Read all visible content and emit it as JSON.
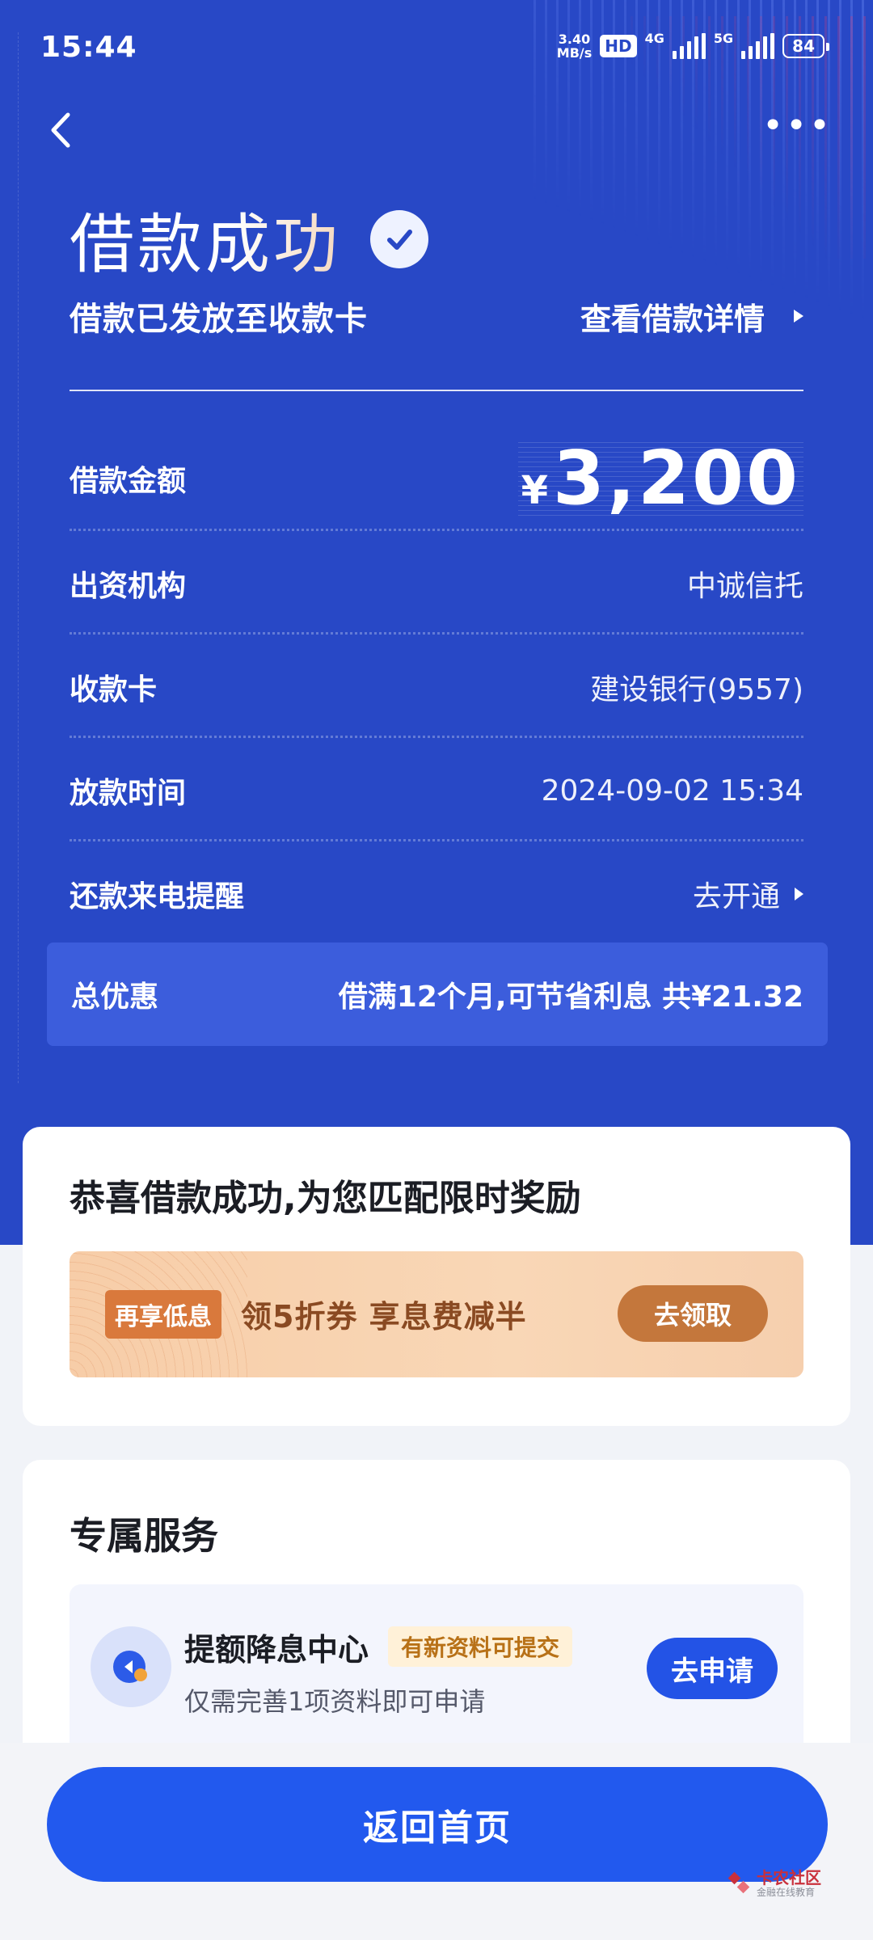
{
  "status_bar": {
    "time": "15:44",
    "speed_value": "3.40",
    "speed_unit": "MB/s",
    "hd": "HD",
    "net1": "4G",
    "net2": "5G",
    "battery": "84"
  },
  "nav": {
    "back_icon": "chevron-left-icon",
    "more_icon": "more-dots-icon"
  },
  "header": {
    "title": "借款成功",
    "subtitle": "借款已发放至收款卡",
    "details_link": "查看借款详情"
  },
  "loan": {
    "amount_label": "借款金额",
    "currency": "¥",
    "amount": "3,200",
    "lender_label": "出资机构",
    "lender": "中诚信托",
    "card_label": "收款卡",
    "card": "建设银行(9557)",
    "time_label": "放款时间",
    "time": "2024-09-02 15:34",
    "reminder_label": "还款来电提醒",
    "reminder_action": "去开通"
  },
  "discount": {
    "label": "总优惠",
    "value": "借满12个月,可节省利息 共¥21.32"
  },
  "reward": {
    "heading": "恭喜借款成功,为您匹配限时奖励",
    "tag": "再享低息",
    "text": "领5折券 享息费减半",
    "button": "去领取"
  },
  "services": {
    "heading": "专属服务",
    "item": {
      "name": "提额降息中心",
      "badge": "有新资料可提交",
      "desc": "仅需完善1项资料即可申请",
      "button": "去申请"
    }
  },
  "footer": {
    "home_button": "返回首页",
    "watermark_main": "卡农社区",
    "watermark_sub": "金融在线教育"
  },
  "colors": {
    "hero_bg": "#2848c6",
    "primary_button": "#2259ee",
    "reward_button": "#c4773c"
  }
}
